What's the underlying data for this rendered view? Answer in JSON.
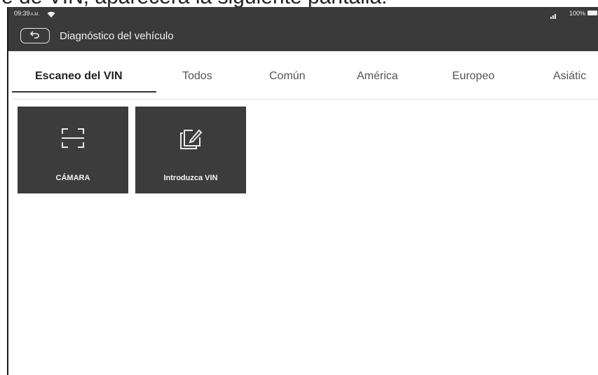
{
  "caption": "e de VIN, aparecerá la siguiente pantalla:",
  "status_bar": {
    "time": "09:39",
    "ampm": "A.M.",
    "battery": "100%"
  },
  "header": {
    "title": "Diagnóstico del vehículo"
  },
  "tabs": [
    {
      "label": "Escaneo del VIN",
      "active": true
    },
    {
      "label": "Todos",
      "active": false
    },
    {
      "label": "Común",
      "active": false
    },
    {
      "label": "América",
      "active": false
    },
    {
      "label": "Europeo",
      "active": false
    },
    {
      "label": "Asiátic",
      "active": false
    }
  ],
  "tiles": [
    {
      "label": "CÁMARA",
      "icon": "scan-frame-icon"
    },
    {
      "label": "Introduzca VIN",
      "icon": "edit-document-icon"
    }
  ]
}
